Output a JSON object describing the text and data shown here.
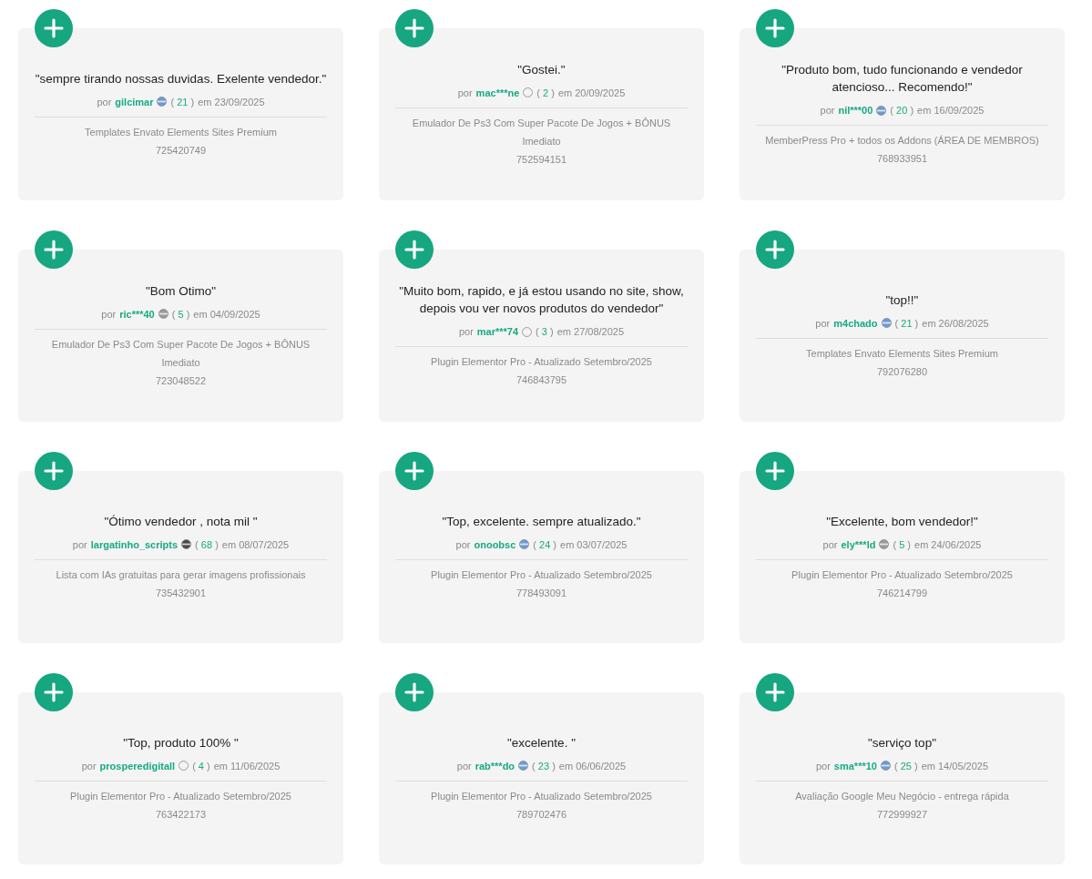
{
  "reviews": [
    {
      "quote": "\"sempre tirando nossas duvidas. Exelente vendedor.\"",
      "byline": {
        "prefix": "por",
        "user": "gilcimar",
        "badge": {
          "color": "#6b9ad8"
        },
        "open": "(",
        "count": "21",
        "close": ")",
        "date": "em 23/09/2025"
      },
      "product": "Templates Envato Elements Sites Premium",
      "code": "725420749"
    },
    {
      "quote": "\"Gostei.\"",
      "byline": {
        "prefix": "por",
        "user": "mac***ne",
        "badge": {
          "color": "#f0f0f0"
        },
        "open": "(",
        "count": "2",
        "close": ")",
        "date": "em 20/09/2025"
      },
      "product": "Emulador De Ps3 Com Super Pacote De Jogos + BÔNUS Imediato",
      "code": "752594151"
    },
    {
      "quote": "\"Produto bom, tudo funcionando e vendedor atencioso... Recomendo!\"",
      "byline": {
        "prefix": "por",
        "user": "nil***00",
        "badge": {
          "color": "#6b9ad8"
        },
        "open": "(",
        "count": "20",
        "close": ")",
        "date": "em 16/09/2025"
      },
      "product": "MemberPress Pro + todos os Addons (ÁREA DE MEMBROS)",
      "code": "768933951"
    },
    {
      "quote": "\"Bom Otimo\"",
      "byline": {
        "prefix": "por",
        "user": "ric***40",
        "badge": {
          "color": "#9a9a9a"
        },
        "open": "(",
        "count": "5",
        "close": ")",
        "date": "em 04/09/2025"
      },
      "product": "Emulador De Ps3 Com Super Pacote De Jogos + BÔNUS Imediato",
      "code": "723048522"
    },
    {
      "quote": "\"Muito bom, rapido, e já estou usando no site, show, depois vou ver novos produtos do vendedor\"",
      "byline": {
        "prefix": "por",
        "user": "mar***74",
        "badge": {
          "color": "#f0f0f0"
        },
        "open": "(",
        "count": "3",
        "close": ")",
        "date": "em 27/08/2025"
      },
      "product": "Plugin Elementor Pro - Atualizado Setembro/2025",
      "code": "746843795"
    },
    {
      "quote": "\"top!!\"",
      "byline": {
        "prefix": "por",
        "user": "m4chado",
        "badge": {
          "color": "#6b9ad8"
        },
        "open": "(",
        "count": "21",
        "close": ")",
        "date": "em 26/08/2025"
      },
      "product": "Templates Envato Elements Sites Premium",
      "code": "792076280"
    },
    {
      "quote": "\"Ótimo vendedor , nota mil \"",
      "byline": {
        "prefix": "por",
        "user": "largatinho_scripts",
        "badge": {
          "color": "#4a4a4a"
        },
        "open": "(",
        "count": "68",
        "close": ")",
        "date": "em 08/07/2025"
      },
      "product": "Lista com IAs gratuitas para gerar imagens profissionais",
      "code": "735432901"
    },
    {
      "quote": "\"Top, excelente. sempre atualizado.\"",
      "byline": {
        "prefix": "por",
        "user": "onoobsc",
        "badge": {
          "color": "#6b9ad8"
        },
        "open": "(",
        "count": "24",
        "close": ")",
        "date": "em 03/07/2025"
      },
      "product": "Plugin Elementor Pro - Atualizado Setembro/2025",
      "code": "778493091"
    },
    {
      "quote": "\"Excelente, bom vendedor!\"",
      "byline": {
        "prefix": "por",
        "user": "ely***ld",
        "badge": {
          "color": "#9a9a9a"
        },
        "open": "(",
        "count": "5",
        "close": ")",
        "date": "em 24/06/2025"
      },
      "product": "Plugin Elementor Pro - Atualizado Setembro/2025",
      "code": "746214799"
    },
    {
      "quote": "\"Top, produto 100% \"",
      "byline": {
        "prefix": "por",
        "user": "prosperedigitall",
        "badge": {
          "color": "#f0f0f0"
        },
        "open": "(",
        "count": "4",
        "close": ")",
        "date": "em 11/06/2025"
      },
      "product": "Plugin Elementor Pro - Atualizado Setembro/2025",
      "code": "763422173"
    },
    {
      "quote": "\"excelente. \"",
      "byline": {
        "prefix": "por",
        "user": "rab***do",
        "badge": {
          "color": "#6b9ad8"
        },
        "open": "(",
        "count": "23",
        "close": ")",
        "date": "em 06/06/2025"
      },
      "product": "Plugin Elementor Pro - Atualizado Setembro/2025",
      "code": "789702476"
    },
    {
      "quote": "\"serviço top\"",
      "byline": {
        "prefix": "por",
        "user": "sma***10",
        "badge": {
          "color": "#6b9ad8"
        },
        "open": "(",
        "count": "25",
        "close": ")",
        "date": "em 14/05/2025"
      },
      "product": "Avaliação Google Meu Negócio - entrega rápida",
      "code": "772999927"
    }
  ]
}
